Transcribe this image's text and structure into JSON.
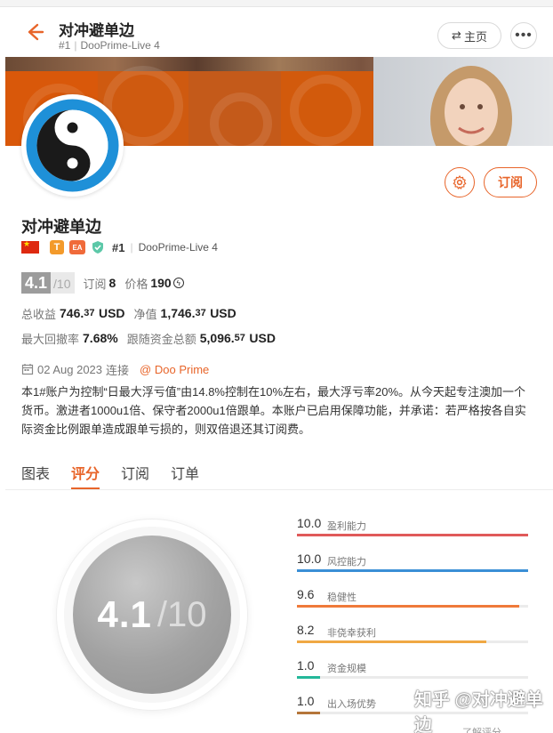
{
  "header": {
    "title": "对冲避单边",
    "subtitle_rank": "#1",
    "subtitle_server": "DooPrime-Live 4",
    "home_label": "主页",
    "more_label": "•••"
  },
  "profile": {
    "name": "对冲避单边",
    "flag": "cn-flag",
    "badge_t": "T",
    "badge_ea": "EA",
    "rank": "#1",
    "server": "DooPrime-Live 4",
    "subscribe_label": "订阅"
  },
  "stats": {
    "score": "4.1",
    "score_max": "/10",
    "subscribe_label": "订阅",
    "subscribe_count": "8",
    "price_label": "价格",
    "price_value": "190",
    "total_profit_label": "总收益",
    "total_profit_main": "746.",
    "total_profit_dec": "37",
    "total_profit_unit": "USD",
    "equity_label": "净值",
    "equity_main": "1,746.",
    "equity_dec": "37",
    "equity_unit": "USD",
    "drawdown_label": "最大回撤率",
    "drawdown_value": "7.68%",
    "follow_funds_label": "跟随资金总额",
    "follow_funds_main": "5,096.",
    "follow_funds_dec": "57",
    "follow_funds_unit": "USD"
  },
  "connection": {
    "date": "02 Aug 2023",
    "connect_label": "连接",
    "broker": "@ Doo Prime"
  },
  "description": "本1#账户为控制“日最大浮亏值”由14.8%控制在10%左右，最大浮亏率20%。从今天起专注澳加一个货币。激进者1000u1倍、保守者2000u1倍跟单。本账户已启用保障功能，并承诺：若严格按各自实际资金比例跟单造成跟单亏损的，则双倍退还其订阅费。",
  "tabs": [
    {
      "label": "图表",
      "active": false
    },
    {
      "label": "评分",
      "active": true
    },
    {
      "label": "订阅",
      "active": false
    },
    {
      "label": "订单",
      "active": false
    }
  ],
  "rating": {
    "score": "4.1",
    "max": "/10",
    "metrics": [
      {
        "value": "10.0",
        "label": "盈利能力",
        "fraction": 1.0,
        "color": "#e05a5a"
      },
      {
        "value": "10.0",
        "label": "风控能力",
        "fraction": 1.0,
        "color": "#3a8fd6"
      },
      {
        "value": "9.6",
        "label": "稳健性",
        "fraction": 0.96,
        "color": "#ef7a3a"
      },
      {
        "value": "8.2",
        "label": "非侥幸获利",
        "fraction": 0.82,
        "color": "#f0a844"
      },
      {
        "value": "1.0",
        "label": "资金规模",
        "fraction": 0.1,
        "color": "#24b89a"
      },
      {
        "value": "1.0",
        "label": "出入场优势",
        "fraction": 0.1,
        "color": "#b5763a"
      }
    ],
    "learn_more": "了解评分"
  },
  "watermark": "知乎 @对冲避单边",
  "colors": {
    "accent": "#e8652a",
    "banner_orange": "#d9580a"
  }
}
